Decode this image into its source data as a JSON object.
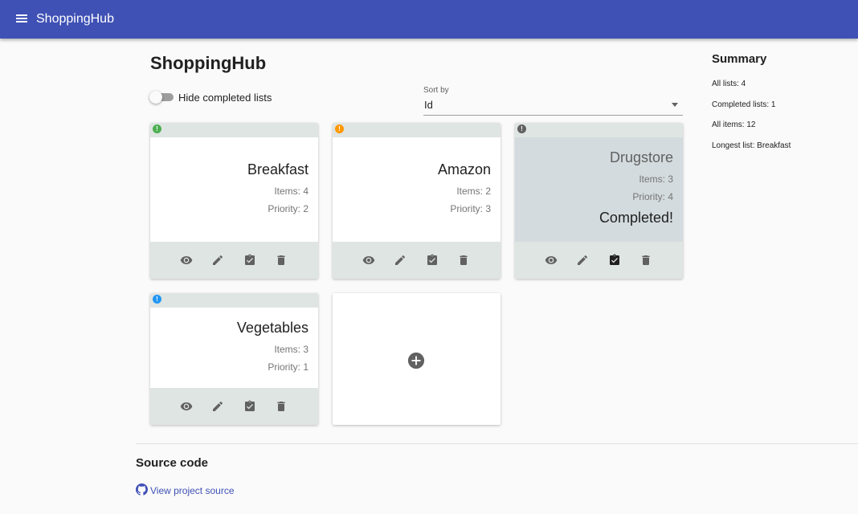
{
  "appbar": {
    "title": "ShoppingHub"
  },
  "page": {
    "title": "ShoppingHub"
  },
  "filters": {
    "hide_completed_label": "Hide completed lists",
    "hide_completed_on": false,
    "sort_label": "Sort by",
    "sort_value": "Id"
  },
  "lists": [
    {
      "name": "Breakfast",
      "items": "Items: 4",
      "priority": "Priority: 2",
      "status_color": "#4caf50",
      "completed": false
    },
    {
      "name": "Amazon",
      "items": "Items: 2",
      "priority": "Priority: 3",
      "status_color": "#ff9800",
      "completed": false
    },
    {
      "name": "Drugstore",
      "items": "Items: 3",
      "priority": "Priority: 4",
      "status_color": "#616161",
      "completed": true,
      "completed_text": "Completed!"
    },
    {
      "name": "Vegetables",
      "items": "Items: 3",
      "priority": "Priority: 1",
      "status_color": "#2196f3",
      "completed": false
    }
  ],
  "card_actions": [
    "eye-icon",
    "pencil-icon",
    "clipboard-check-icon",
    "trash-icon"
  ],
  "add_card": {
    "icon": "plus-circle-icon"
  },
  "summary": {
    "title": "Summary",
    "all_lists": "All lists: 4",
    "completed_lists": "Completed lists: 1",
    "all_items": "All items: 12",
    "longest_list": "Longest list: Breakfast"
  },
  "footer": {
    "source_title": "Source code",
    "source_link": "View project source"
  },
  "colors": {
    "primary": "#3f51b5",
    "card_band": "#dfe5e2",
    "completed_bg": "#d3dbde"
  }
}
